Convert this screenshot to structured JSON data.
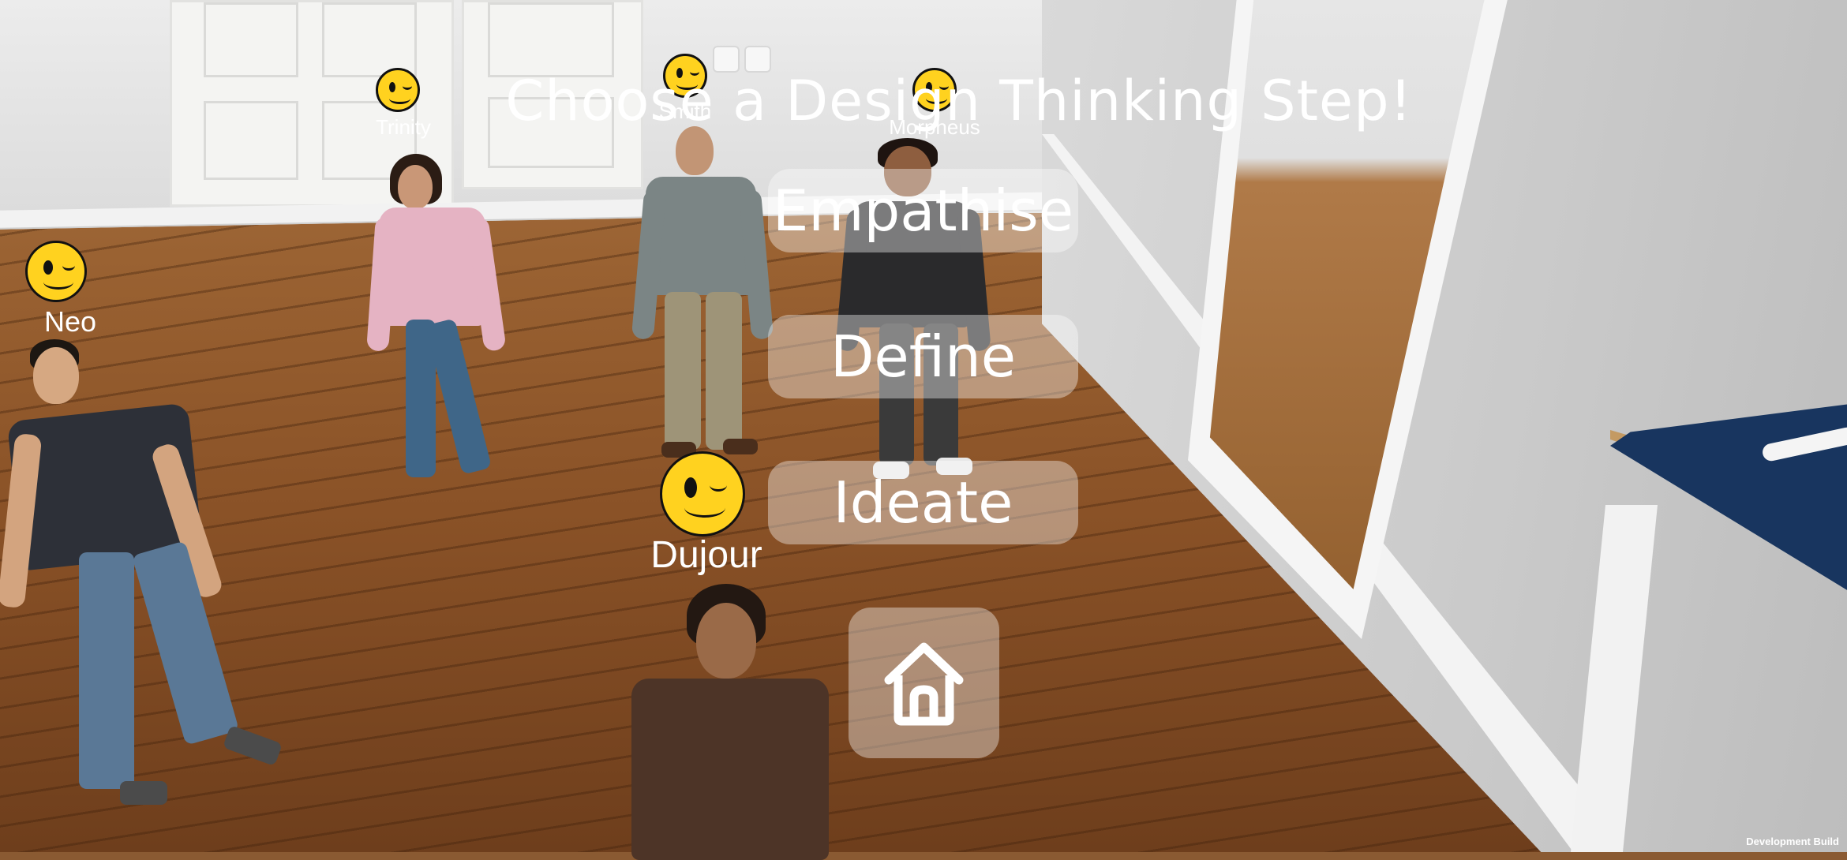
{
  "screen": {
    "title": "Choose a Design Thinking Step!",
    "footer_badge": "Development Build"
  },
  "menu": {
    "steps": [
      {
        "label": "Empathise"
      },
      {
        "label": "Define"
      },
      {
        "label": "Ideate"
      }
    ],
    "home_icon": "house-icon"
  },
  "avatars": [
    {
      "name": "Neo",
      "emoji": "winking-face-icon"
    },
    {
      "name": "Trinity",
      "emoji": "winking-face-icon"
    },
    {
      "name": "Smith",
      "emoji": "winking-face-icon"
    },
    {
      "name": "Morpheus",
      "emoji": "winking-face-icon"
    },
    {
      "name": "Dujour",
      "emoji": "winking-face-icon"
    }
  ],
  "colors": {
    "button_bg": "rgba(255,255,255,0.38)",
    "text": "#ffffff",
    "emoji_face": "#ffd21f"
  }
}
